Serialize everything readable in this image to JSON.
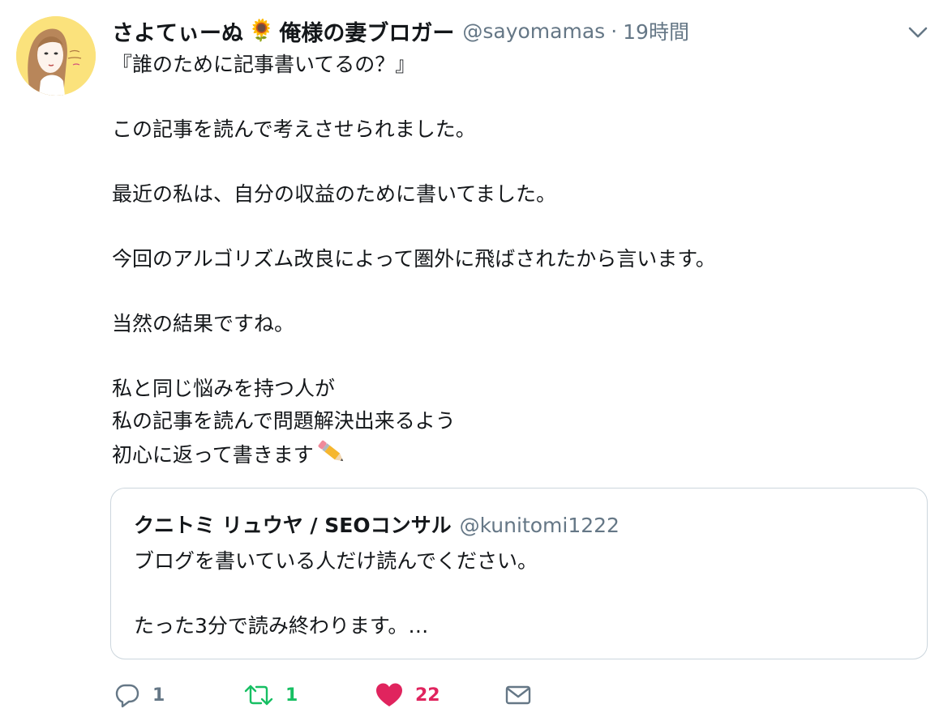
{
  "tweet": {
    "display_name": "さよてぃーぬ",
    "display_name_emoji": "🌻",
    "display_name_suffix": "俺様の妻ブロガー",
    "handle": "@sayomamas",
    "separator": "·",
    "time": "19時間",
    "lines": [
      "『誰のために記事書いてるの？』",
      "",
      "この記事を読んで考えさせられました。",
      "",
      "最近の私は、自分の収益のために書いてました。",
      "",
      "今回のアルゴリズム改良によって圏外に飛ばされたから言います。",
      "",
      "当然の結果ですね。",
      "",
      "私と同じ悩みを持つ人が",
      "私の記事を読んで問題解決出来るよう",
      "初心に返って書きます"
    ]
  },
  "quoted": {
    "display_name": "クニトミ リュウヤ / SEOコンサル",
    "handle": "@kunitomi1222",
    "lines": [
      "ブログを書いている人だけ読んでください。",
      "",
      "たった3分で読み終わります。…"
    ]
  },
  "actions": {
    "reply_count": "1",
    "retweet_count": "1",
    "like_count": "22"
  },
  "colors": {
    "text": "#14171a",
    "secondary": "#657786",
    "retweet": "#17bf63",
    "like": "#e0245e",
    "border": "#ccd6dd"
  },
  "icons": {
    "reply": "reply-icon",
    "retweet": "retweet-icon",
    "like": "heart-icon",
    "dm": "envelope-icon",
    "caret": "chevron-down-icon",
    "pencil": "pencil-emoji"
  }
}
